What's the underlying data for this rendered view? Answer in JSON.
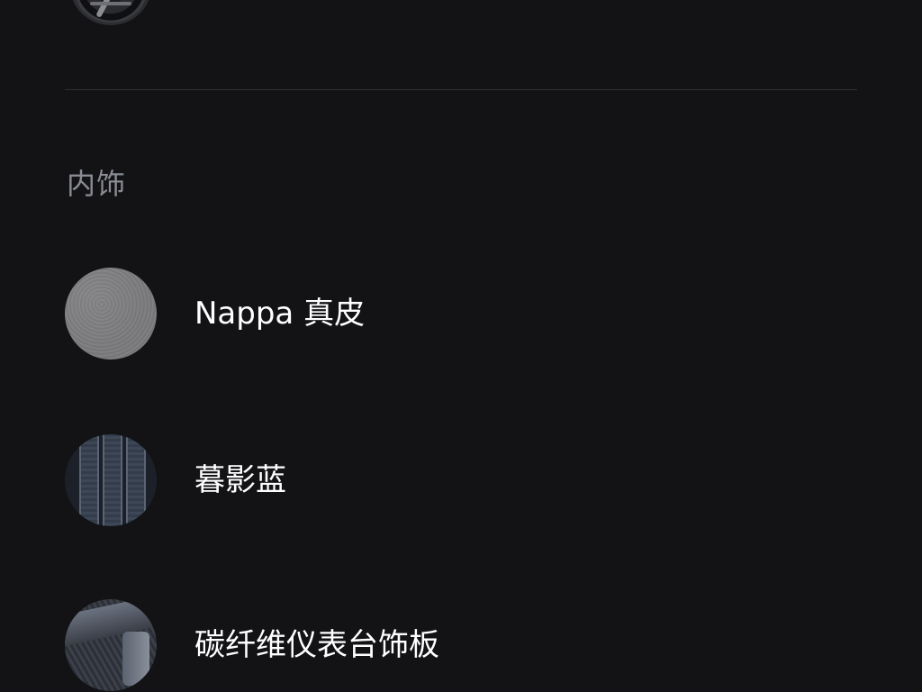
{
  "top_item": {
    "thumbnail_icon": "wheel-icon"
  },
  "interior": {
    "section_title": "内饰",
    "options": [
      {
        "label": "Nappa 真皮",
        "swatch": "nappa-leather-swatch",
        "swatch_color": "#7b7b7e"
      },
      {
        "label": "暮影蓝",
        "swatch": "dusk-blue-swatch",
        "swatch_color": "#1c2028"
      },
      {
        "label": "碳纤维仪表台饰板",
        "swatch": "carbon-fiber-trim-swatch",
        "swatch_color": "#30333a"
      }
    ]
  }
}
